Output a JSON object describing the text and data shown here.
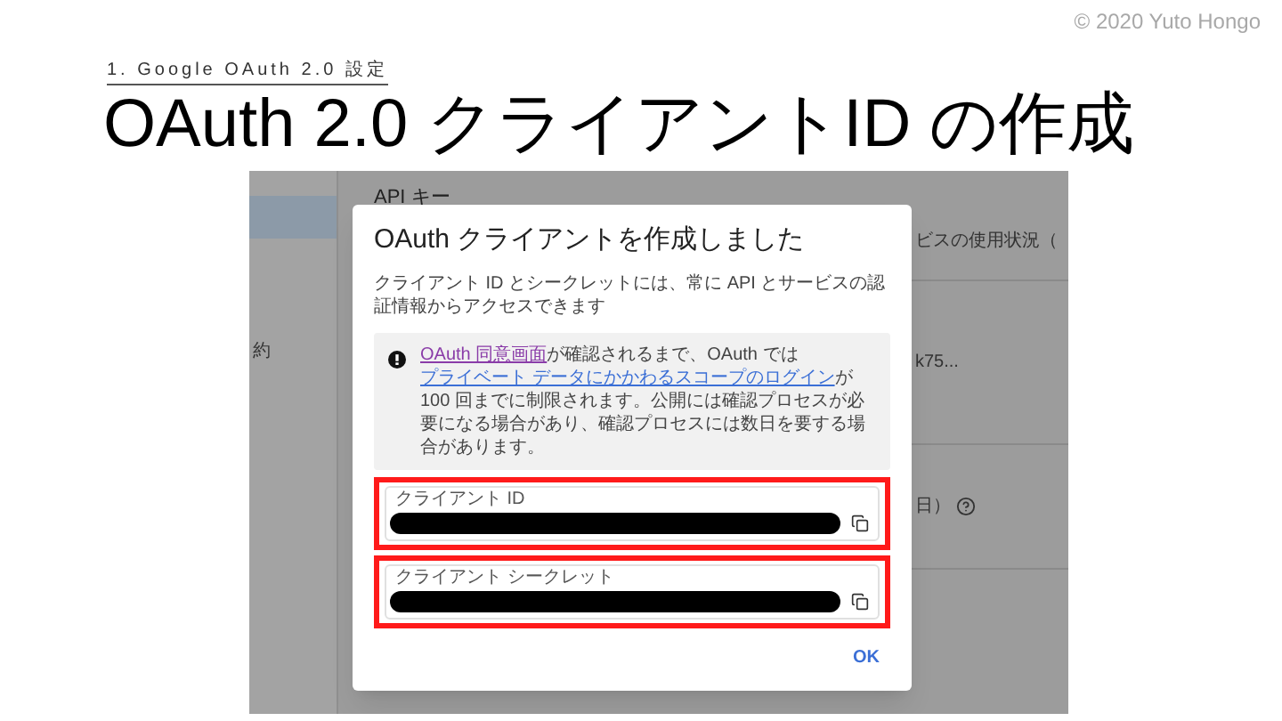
{
  "slide": {
    "copyright": "© 2020 Yuto Hongo",
    "section": "1. Google OAuth 2.0 設定",
    "title": "OAuth 2.0 クライアントID の作成"
  },
  "background_page": {
    "heading": "API キー",
    "sidebar_text": "約",
    "column_texts": [
      {
        "text": "ビスの使用状況（",
        "help": false
      },
      {
        "text": "k75...",
        "help": false
      },
      {
        "text": "日）",
        "help": true
      }
    ]
  },
  "dialog": {
    "title": "OAuth クライアントを作成しました",
    "description": "クライアント ID とシークレットには、常に API とサービスの認証情報からアクセスできます",
    "notice": [
      {
        "kind": "link",
        "visited": true,
        "text": "OAuth 同意画面"
      },
      {
        "kind": "text",
        "text": "が確認されるまで、OAuth では"
      },
      {
        "kind": "link",
        "visited": false,
        "text": "プライベート データにかかわるスコープのログイン"
      },
      {
        "kind": "text",
        "text": "が 100 回までに制限されます。公開には確認プロセスが必要になる場合があり、確認プロセスには数日を要する場合があります。"
      }
    ],
    "fields": [
      {
        "label": "クライアント ID",
        "value_redacted": true,
        "highlighted": true
      },
      {
        "label": "クライアント シークレット",
        "value_redacted": true,
        "highlighted": true
      }
    ],
    "ok_button": "OK"
  }
}
